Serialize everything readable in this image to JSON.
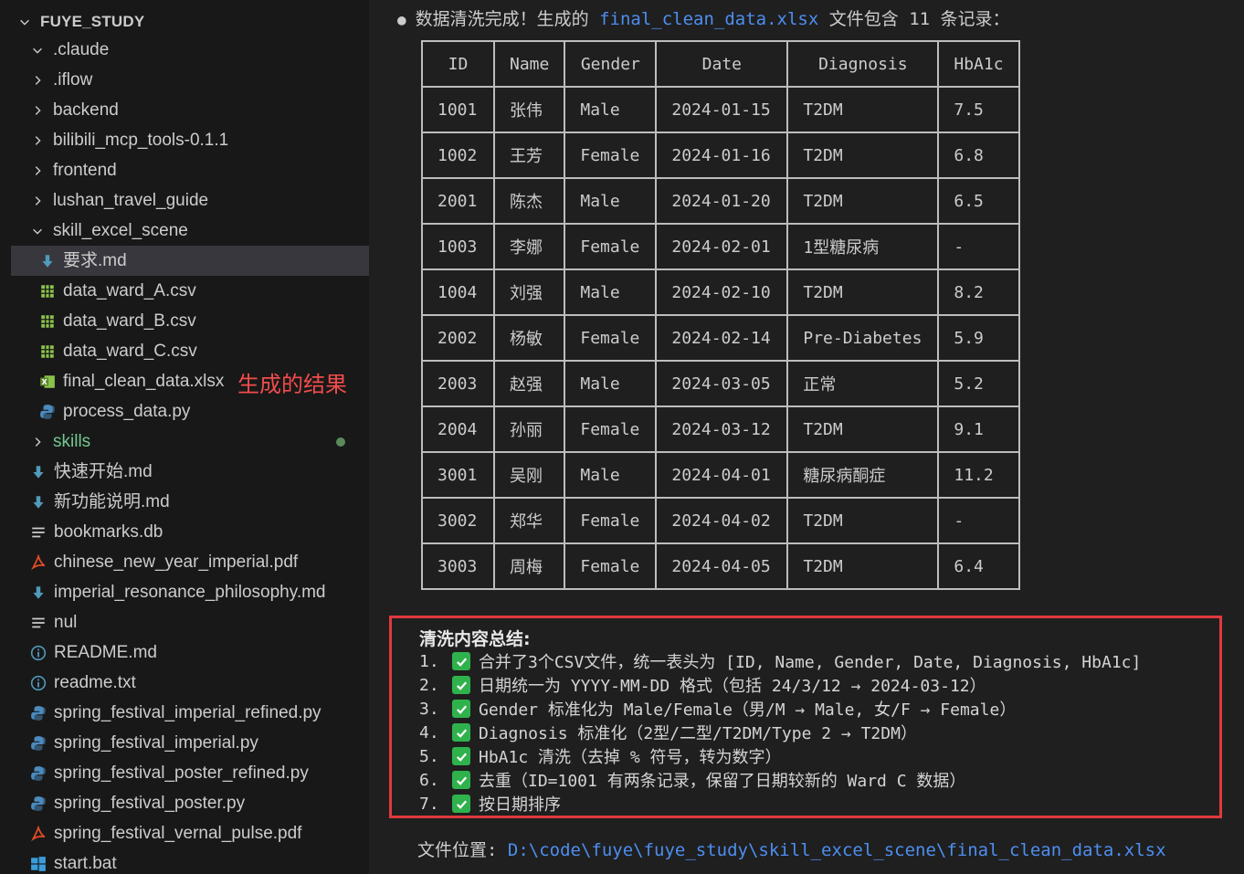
{
  "explorer": {
    "root": "FUYE_STUDY",
    "items": [
      {
        "label": ".claude",
        "kind": "folder-open",
        "depth": 1
      },
      {
        "label": ".iflow",
        "kind": "folder",
        "depth": 1
      },
      {
        "label": "backend",
        "kind": "folder",
        "depth": 1
      },
      {
        "label": "bilibili_mcp_tools-0.1.1",
        "kind": "folder",
        "depth": 1
      },
      {
        "label": "frontend",
        "kind": "folder",
        "depth": 1
      },
      {
        "label": "lushan_travel_guide",
        "kind": "folder",
        "depth": 1
      },
      {
        "label": "skill_excel_scene",
        "kind": "folder-open",
        "depth": 1
      },
      {
        "label": "要求.md",
        "kind": "markdown",
        "depth": 2,
        "selected": true
      },
      {
        "label": "data_ward_A.csv",
        "kind": "csv",
        "depth": 2
      },
      {
        "label": "data_ward_B.csv",
        "kind": "csv",
        "depth": 2
      },
      {
        "label": "data_ward_C.csv",
        "kind": "csv",
        "depth": 2
      },
      {
        "label": "final_clean_data.xlsx",
        "kind": "excel",
        "depth": 2
      },
      {
        "label": "process_data.py",
        "kind": "python",
        "depth": 2
      },
      {
        "label": "skills",
        "kind": "folder",
        "depth": 1,
        "modified": true
      },
      {
        "label": "快速开始.md",
        "kind": "markdown",
        "depth": 1
      },
      {
        "label": "新功能说明.md",
        "kind": "markdown",
        "depth": 1
      },
      {
        "label": "bookmarks.db",
        "kind": "lines",
        "depth": 1
      },
      {
        "label": "chinese_new_year_imperial.pdf",
        "kind": "pdf",
        "depth": 1
      },
      {
        "label": "imperial_resonance_philosophy.md",
        "kind": "markdown",
        "depth": 1
      },
      {
        "label": "nul",
        "kind": "lines",
        "depth": 1
      },
      {
        "label": "README.md",
        "kind": "info",
        "depth": 1
      },
      {
        "label": "readme.txt",
        "kind": "info",
        "depth": 1
      },
      {
        "label": "spring_festival_imperial_refined.py",
        "kind": "python",
        "depth": 1
      },
      {
        "label": "spring_festival_imperial.py",
        "kind": "python",
        "depth": 1
      },
      {
        "label": "spring_festival_poster_refined.py",
        "kind": "python",
        "depth": 1
      },
      {
        "label": "spring_festival_poster.py",
        "kind": "python",
        "depth": 1
      },
      {
        "label": "spring_festival_vernal_pulse.pdf",
        "kind": "pdf",
        "depth": 1
      },
      {
        "label": "start.bat",
        "kind": "windows",
        "depth": 1
      }
    ],
    "annotation": "生成的结果"
  },
  "main": {
    "headline": {
      "bullet": "●",
      "prefix": "数据清洗完成！生成的 ",
      "file": "final_clean_data.xlsx",
      "middle": " 文件包含 ",
      "count": "11",
      "suffix": " 条记录："
    },
    "table": {
      "headers": [
        "ID",
        "Name",
        "Gender",
        "Date",
        "Diagnosis",
        "HbA1c"
      ],
      "rows": [
        [
          "1001",
          "张伟",
          "Male",
          "2024-01-15",
          "T2DM",
          "7.5"
        ],
        [
          "1002",
          "王芳",
          "Female",
          "2024-01-16",
          "T2DM",
          "6.8"
        ],
        [
          "2001",
          "陈杰",
          "Male",
          "2024-01-20",
          "T2DM",
          "6.5"
        ],
        [
          "1003",
          "李娜",
          "Female",
          "2024-02-01",
          "1型糖尿病",
          "-"
        ],
        [
          "1004",
          "刘强",
          "Male",
          "2024-02-10",
          "T2DM",
          "8.2"
        ],
        [
          "2002",
          "杨敏",
          "Female",
          "2024-02-14",
          "Pre-Diabetes",
          "5.9"
        ],
        [
          "2003",
          "赵强",
          "Male",
          "2024-03-05",
          "正常",
          "5.2"
        ],
        [
          "2004",
          "孙丽",
          "Female",
          "2024-03-12",
          "T2DM",
          "9.1"
        ],
        [
          "3001",
          "吴刚",
          "Male",
          "2024-04-01",
          "糖尿病酮症",
          "11.2"
        ],
        [
          "3002",
          "郑华",
          "Female",
          "2024-04-02",
          "T2DM",
          "-"
        ],
        [
          "3003",
          "周梅",
          "Female",
          "2024-04-05",
          "T2DM",
          "6.4"
        ]
      ]
    },
    "summary": {
      "title": "清洗内容总结:",
      "items": [
        {
          "num": "1.",
          "text": "合并了3个CSV文件，统一表头为 [ID, Name, Gender, Date, Diagnosis, HbA1c]"
        },
        {
          "num": "2.",
          "text": "日期统一为 YYYY-MM-DD 格式（包括 24/3/12 → 2024-03-12）"
        },
        {
          "num": "3.",
          "text": "Gender 标准化为 Male/Female（男/M → Male, 女/F → Female）"
        },
        {
          "num": "4.",
          "text": "Diagnosis 标准化（2型/二型/T2DM/Type 2 → T2DM）"
        },
        {
          "num": "5.",
          "text": "HbA1c 清洗（去掉 % 符号，转为数字）"
        },
        {
          "num": "6.",
          "text": "去重（ID=1001 有两条记录，保留了日期较新的 Ward C 数据）"
        },
        {
          "num": "7.",
          "text": "按日期排序"
        }
      ]
    },
    "file_location": {
      "label": "文件位置: ",
      "path": "D:\\code\\fuye\\fuye_study\\skill_excel_scene\\final_clean_data.xlsx"
    }
  },
  "colors": {
    "link_blue": "#4d8ef0",
    "annotation_red": "#f14c4c",
    "box_red": "#e0393e",
    "check_green": "#2fb24c",
    "csv_green": "#8bc34a",
    "python_blue": "#4b8bbe",
    "pdf_red": "#e34c26"
  }
}
